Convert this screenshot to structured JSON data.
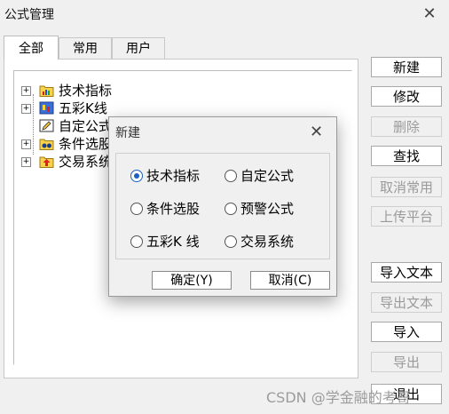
{
  "window": {
    "title": "公式管理"
  },
  "tabs": [
    {
      "label": "全部"
    },
    {
      "label": "常用"
    },
    {
      "label": "用户"
    }
  ],
  "tree": [
    {
      "label": "技术指标",
      "icon": "bar-chart-folder-icon"
    },
    {
      "label": "五彩K线",
      "icon": "candlestick-folder-icon"
    },
    {
      "label": "自定公式",
      "icon": "pencil-icon"
    },
    {
      "label": "条件选股",
      "icon": "binoculars-folder-icon"
    },
    {
      "label": "交易系统",
      "icon": "up-arrow-folder-icon"
    }
  ],
  "buttons": [
    {
      "label": "新建",
      "enabled": true
    },
    {
      "label": "修改",
      "enabled": true
    },
    {
      "label": "删除",
      "enabled": false
    },
    {
      "label": "查找",
      "enabled": true
    },
    {
      "label": "取消常用",
      "enabled": false
    },
    {
      "label": "上传平台",
      "enabled": false
    },
    {
      "label": "导入文本",
      "enabled": true
    },
    {
      "label": "导出文本",
      "enabled": false
    },
    {
      "label": "导入",
      "enabled": true
    },
    {
      "label": "导出",
      "enabled": false
    },
    {
      "label": "退出",
      "enabled": true
    }
  ],
  "dialog": {
    "title": "新建",
    "options": [
      {
        "label": "技术指标",
        "selected": true
      },
      {
        "label": "自定公式",
        "selected": false
      },
      {
        "label": "条件选股",
        "selected": false
      },
      {
        "label": "预警公式",
        "selected": false
      },
      {
        "label": "五彩K 线",
        "selected": false
      },
      {
        "label": "交易系统",
        "selected": false
      }
    ],
    "ok_label": "确定(Y)",
    "cancel_label": "取消(C)"
  },
  "watermark": "CSDN @学金融的考哥",
  "colors": {
    "accent": "#1f5fbf",
    "background": "#f0f0f0"
  }
}
